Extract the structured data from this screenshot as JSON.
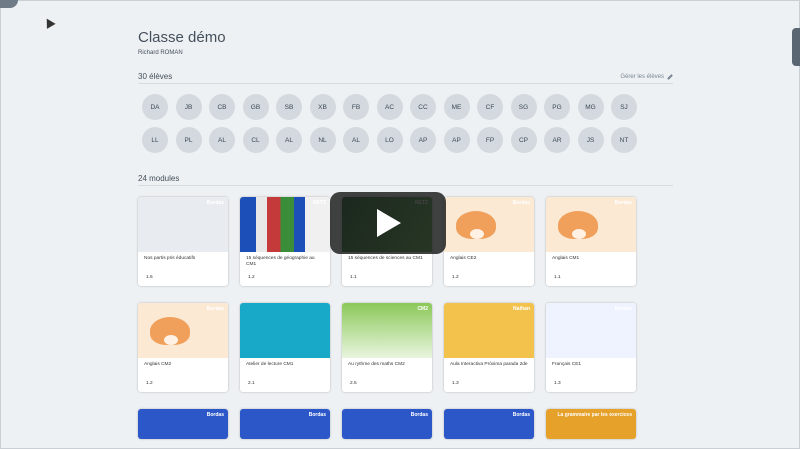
{
  "class": {
    "title": "Classe démo",
    "teacher": "Richard ROMAN"
  },
  "students": {
    "heading": "30 élèves",
    "manage_label": "Gérer les élèves",
    "initials": [
      "DA",
      "JB",
      "CB",
      "GB",
      "SB",
      "XB",
      "FB",
      "AC",
      "CC",
      "ME",
      "CF",
      "SG",
      "PG",
      "MG",
      "SJ",
      "LL",
      "PL",
      "AL",
      "CL",
      "AL",
      "NL",
      "AL",
      "LO",
      "AP",
      "AP",
      "FP",
      "CP",
      "AR",
      "JS",
      "NT"
    ]
  },
  "modules": {
    "heading": "24 modules",
    "items": [
      {
        "title": "Nos partis pris éducatifs",
        "version": "1.6",
        "thumb": "bordas",
        "brand": "Bordas"
      },
      {
        "title": "15 séquences de géographie au CM1",
        "version": "1.2",
        "thumb": "retz-flags",
        "brand": "RETZ"
      },
      {
        "title": "15 séquences de sciences au CM1",
        "version": "1.1",
        "thumb": "retz-sciences",
        "brand": "RETZ"
      },
      {
        "title": "Anglais CE2",
        "version": "1.2",
        "thumb": "fox",
        "brand": "Bordas"
      },
      {
        "title": "Anglais CM1",
        "version": "1.1",
        "thumb": "fox",
        "brand": "Bordas"
      },
      {
        "title": "Anglais CM2",
        "version": "1.2",
        "thumb": "fox",
        "brand": "Bordas"
      },
      {
        "title": "Atelier de lecture CM1",
        "version": "2.1",
        "thumb": "atelier",
        "brand": ""
      },
      {
        "title": "Au rythme des maths CM2",
        "version": "2.5",
        "thumb": "maths",
        "brand": "CM2"
      },
      {
        "title": "Aula Interactiva Próxima parada 2de",
        "version": "1.3",
        "thumb": "proxima",
        "brand": "Nathan"
      },
      {
        "title": "Français CE1",
        "version": "1.3",
        "thumb": "francais",
        "brand": "Bordas"
      },
      {
        "title": "",
        "version": "",
        "thumb": "blue",
        "brand": "Bordas"
      },
      {
        "title": "",
        "version": "",
        "thumb": "blue",
        "brand": "Bordas"
      },
      {
        "title": "",
        "version": "",
        "thumb": "blue",
        "brand": "Bordas"
      },
      {
        "title": "",
        "version": "",
        "thumb": "blue",
        "brand": "Bordas"
      },
      {
        "title": "",
        "version": "",
        "thumb": "grammaire",
        "brand": "La grammaire par les exercices"
      }
    ]
  },
  "overlay": {
    "icon": "play-icon"
  }
}
